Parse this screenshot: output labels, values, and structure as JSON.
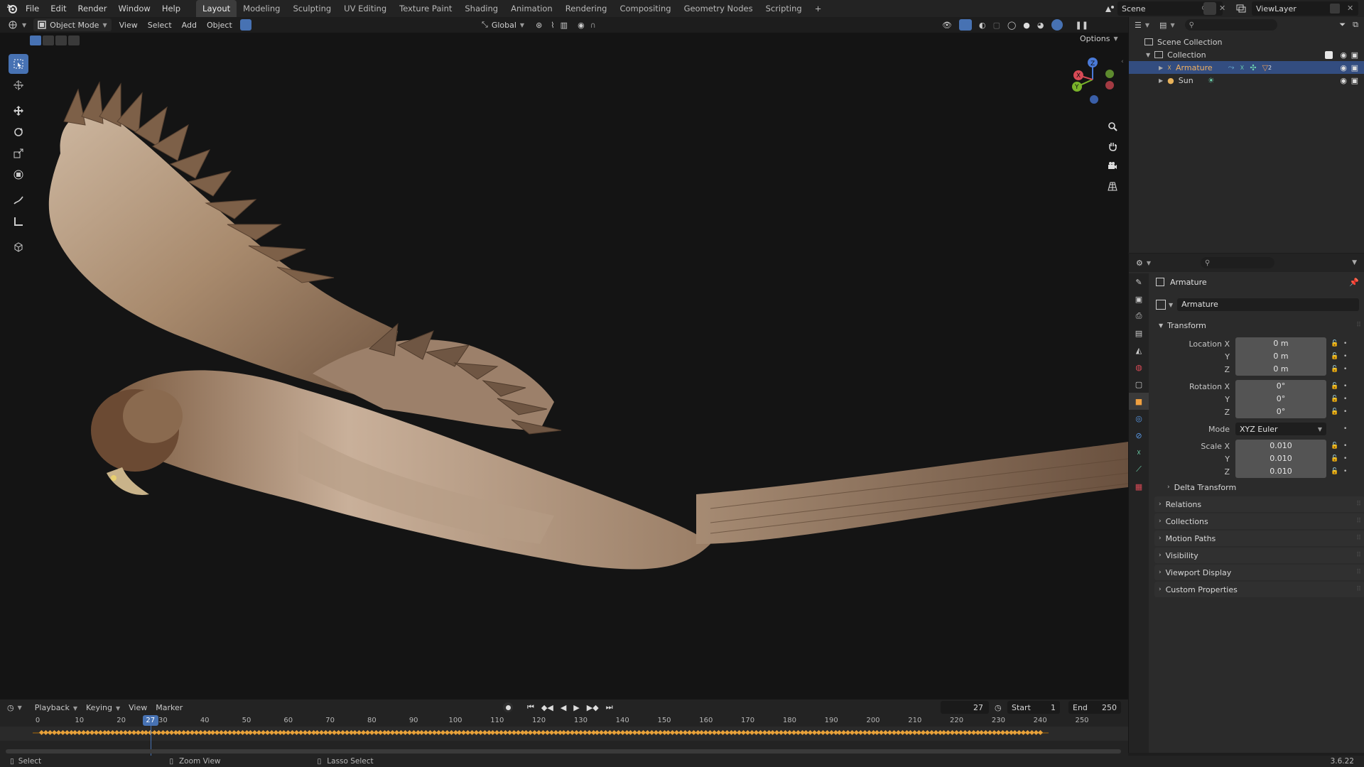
{
  "topbar": {
    "menus": [
      "File",
      "Edit",
      "Render",
      "Window",
      "Help"
    ],
    "workspaces": [
      "Layout",
      "Modeling",
      "Sculpting",
      "UV Editing",
      "Texture Paint",
      "Shading",
      "Animation",
      "Rendering",
      "Compositing",
      "Geometry Nodes",
      "Scripting"
    ],
    "active_workspace": "Layout",
    "scene": "Scene",
    "view_layer": "ViewLayer"
  },
  "viewport_header": {
    "mode": "Object Mode",
    "menus": [
      "View",
      "Select",
      "Add",
      "Object"
    ],
    "orientation": "Global",
    "options": "Options"
  },
  "outliner": {
    "items": [
      {
        "label": "Scene Collection"
      },
      {
        "label": "Collection"
      },
      {
        "label": "Armature",
        "badge": "2"
      },
      {
        "label": "Sun"
      }
    ]
  },
  "properties": {
    "object_name": "Armature",
    "datablock": "Armature",
    "transform_title": "Transform",
    "location": {
      "label_x": "Location X",
      "label_y": "Y",
      "label_z": "Z",
      "x": "0 m",
      "y": "0 m",
      "z": "0 m"
    },
    "rotation": {
      "label_x": "Rotation X",
      "label_y": "Y",
      "label_z": "Z",
      "x": "0°",
      "y": "0°",
      "z": "0°"
    },
    "mode_label": "Mode",
    "mode_value": "XYZ Euler",
    "scale": {
      "label_x": "Scale X",
      "label_y": "Y",
      "label_z": "Z",
      "x": "0.010",
      "y": "0.010",
      "z": "0.010"
    },
    "delta_transform": "Delta Transform",
    "panels": [
      "Relations",
      "Collections",
      "Motion Paths",
      "Visibility",
      "Viewport Display",
      "Custom Properties"
    ]
  },
  "timeline": {
    "menus": [
      "Playback",
      "Keying",
      "View",
      "Marker"
    ],
    "current_frame": "27",
    "start_label": "Start",
    "start": "1",
    "end_label": "End",
    "end": "250",
    "ticks": [
      "0",
      "10",
      "20",
      "30",
      "40",
      "50",
      "60",
      "70",
      "80",
      "90",
      "100",
      "110",
      "120",
      "130",
      "140",
      "150",
      "160",
      "170",
      "180",
      "190",
      "200",
      "210",
      "220",
      "230",
      "240",
      "250"
    ],
    "frame_indicator": "27"
  },
  "statusbar": {
    "select": "Select",
    "zoom": "Zoom View",
    "lasso": "Lasso Select",
    "version": "3.6.22"
  },
  "colors": {
    "accent": "#4772b3",
    "selection": "#334d80",
    "keyframe": "#e8a23a",
    "viewport_bg": "#141414"
  }
}
